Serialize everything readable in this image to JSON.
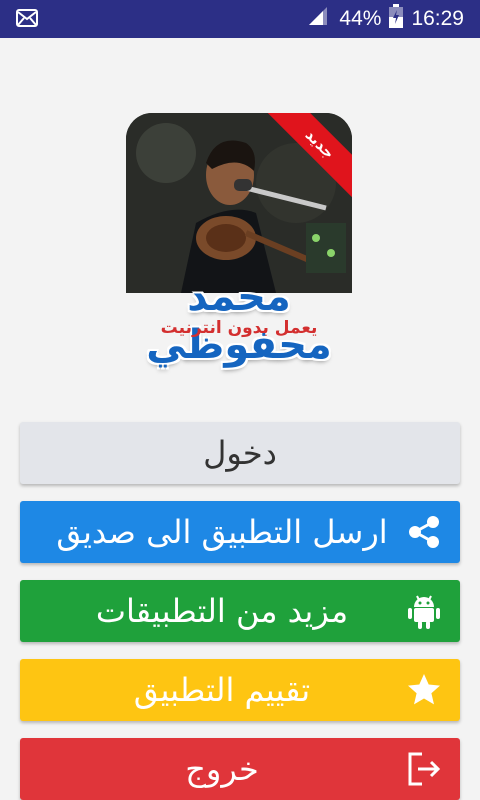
{
  "status_bar": {
    "battery_percent": "44%",
    "time": "16:29",
    "icons": [
      "mail-icon",
      "signal-icon",
      "battery-icon"
    ]
  },
  "logo": {
    "badge": "جديد",
    "title": "محمد محفوظي",
    "subtitle": "يعمل بدون انترنيت"
  },
  "buttons": {
    "login": "دخول",
    "share": "ارسل التطبيق الى صديق",
    "more_apps": "مزيد من التطبيقات",
    "rate": "تقييم التطبيق",
    "exit": "خروج"
  },
  "colors": {
    "status_bar": "#2c2f86",
    "login": "#e3e5ea",
    "share": "#1e88e5",
    "more_apps": "#1fa13b",
    "rate": "#fec512",
    "exit": "#e0353a"
  }
}
